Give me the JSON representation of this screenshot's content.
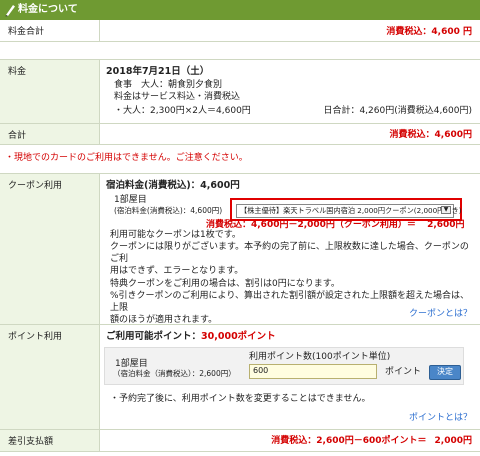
{
  "header": {
    "title": "料金について"
  },
  "total_fee": {
    "label": "料金合計",
    "value": "消費税込：4,600 円"
  },
  "fee": {
    "label": "料金",
    "date": "2018年7月21日（土）",
    "meal": "食事　大人：朝食別夕食別",
    "note": "料金はサービス料込・消費税込",
    "adult": "・大人：2,300円×2人＝4,600円",
    "daily": "日合計：4,260円(消費税込4,600円)"
  },
  "subtotal": {
    "label": "合計",
    "value": "消費税込：4,600円"
  },
  "warning": "・現地でのカードのご利用はできません。ご注意ください。",
  "coupon": {
    "label": "クーポン利用",
    "title": "宿泊料金(消費税込)：4,600円",
    "room": "1部屋目",
    "room_fee": "(宿泊料金(消費税込)：4,600円)",
    "select_value": "【株主優待】楽天トラベル国内宿泊 2,000円クーポン(2,000円引き)",
    "calc_prefix": "消費税込：4,600円－2,000円（クーポン利用）＝",
    "calc_result": "2,600円",
    "notes": [
      "利用可能なクーポンは1枚です。",
      "クーポンには限りがございます。本予約の完了前に、上限枚数に達した場合、クーポンのご利",
      "用はできず、エラーとなります。",
      "特典クーポンをご利用の場合は、割引は0円になります。",
      "%引きクーポンのご利用により、算出された割引額が設定された上限額を超えた場合は、上限",
      "額のほうが適用されます。"
    ],
    "link": "クーポンとは？"
  },
  "points": {
    "label": "ポイント利用",
    "available_prefix": "ご利用可能ポイント：",
    "available_value": "30,000ポイント",
    "room": "1部屋目",
    "room_fee": "（宿泊料金（消費税込）：2,600円）",
    "input_label": "利用ポイント数(100ポイント単位)",
    "input_value": "600",
    "unit": "ポイント",
    "button": "決定",
    "note": "・予約完了後に、利用ポイント数を変更することはできません。",
    "link": "ポイントとは？"
  },
  "final": {
    "label": "差引支払額",
    "prefix": "消費税込：2,600円－600ポイント＝",
    "result": "2,000円"
  },
  "colors": {
    "header": "#6f9a32",
    "label_bg": "#eef5e4",
    "accent_red": "#d40000",
    "highlight_border": "#e00000"
  }
}
